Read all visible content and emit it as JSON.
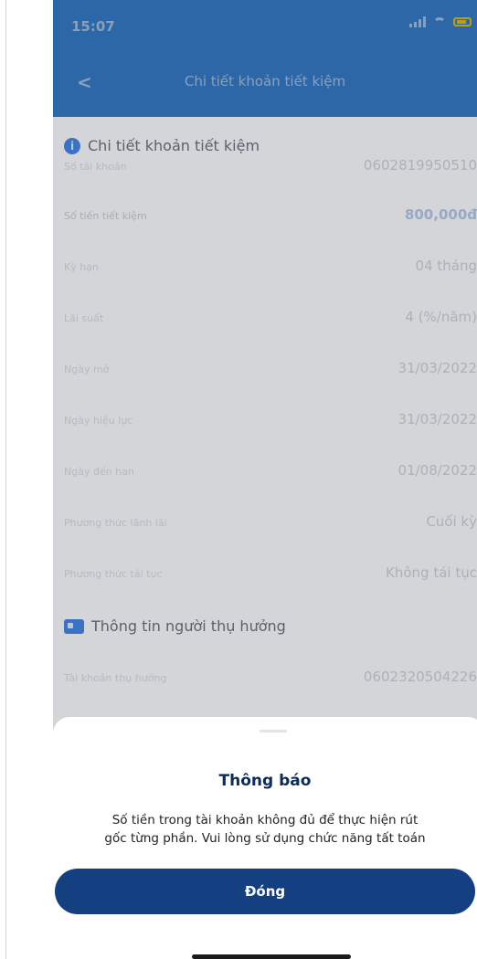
{
  "status_bar": {
    "time": "15:07"
  },
  "header": {
    "back_glyph": "<",
    "title": "Chi tiết khoản tiết kiệm"
  },
  "section1": {
    "title": "Chi tiết khoản tiết kiệm",
    "rows": [
      {
        "label": "Số tài khoản",
        "value": "0602819950510"
      },
      {
        "label": "Số tiền tiết kiệm",
        "value": "800,000đ"
      },
      {
        "label": "Kỳ hạn",
        "value": "04 tháng"
      },
      {
        "label": "Lãi suất",
        "value": "4 (%/năm)"
      },
      {
        "label": "Ngày mở",
        "value": "31/03/2022"
      },
      {
        "label": "Ngày hiệu lực",
        "value": "31/03/2022"
      },
      {
        "label": "Ngày đến hạn",
        "value": "01/08/2022"
      },
      {
        "label": "Phương thức lãnh lãi",
        "value": "Cuối kỳ"
      },
      {
        "label": "Phương thức tái tục",
        "value": "Không tái tục"
      }
    ]
  },
  "section2": {
    "title": "Thông tin người thụ hưởng",
    "rows": [
      {
        "label": "Tài khoản thụ hưởng",
        "value": "0602320504226"
      }
    ]
  },
  "dialog": {
    "title": "Thông báo",
    "message_line1": "Số tiền trong tài khoản không đủ để thực hiện rút",
    "message_line2": "gốc từng phần. Vui lòng sử dụng chức năng tất toán",
    "button_label": "Đóng"
  },
  "colors": {
    "header": "#1b63b0",
    "primary_button": "#143f80",
    "accent": "#2e6fd0"
  },
  "icons": [
    "info-icon",
    "id-card-icon",
    "back-arrow-icon",
    "signal-icon",
    "wifi-icon",
    "battery-icon"
  ]
}
